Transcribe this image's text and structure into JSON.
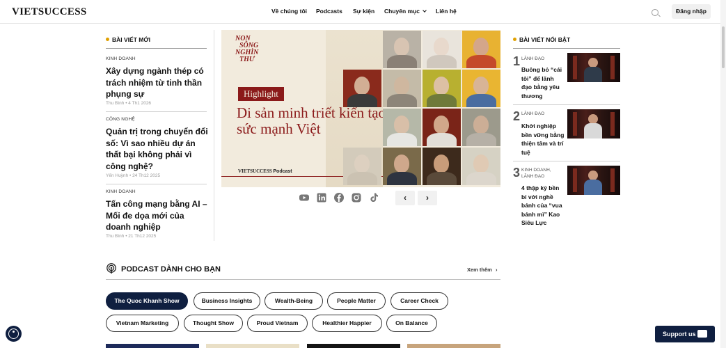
{
  "header": {
    "logo": "VIETSUCCESS",
    "nav": [
      {
        "label": "Về chúng tôi"
      },
      {
        "label": "Podcasts"
      },
      {
        "label": "Sự kiện"
      },
      {
        "label": "Chuyên mục"
      },
      {
        "label": "Liên hệ"
      }
    ],
    "login_label": "Đăng nhập"
  },
  "latest": {
    "title": "BÀI VIẾT MỚI",
    "articles": [
      {
        "category": "KINH DOANH",
        "title": "Xây dựng ngành thép có trách nhiệm từ tinh thần phụng sự",
        "author": "Thu Bình",
        "date": "4 Th1 2026"
      },
      {
        "category": "CÔNG NGHỆ",
        "title": "Quản trị trong chuyển đổi số: Vì sao nhiều dự án thất bại không phải vì công nghệ?",
        "author": "Yến Huỳnh",
        "date": "24 Th12 2025"
      },
      {
        "category": "KINH DOANH",
        "title": "Tấn công mạng bằng AI – Mối đe dọa mới của doanh nghiệp",
        "author": "Thu Bình",
        "date": "21 Th12 2025"
      }
    ]
  },
  "hero": {
    "logo_lines": [
      "NON",
      "SÔNG",
      "NGHÌN",
      "THƯ"
    ],
    "badge": "Highlight",
    "title": "Di sản minh triết kiến tạo sức mạnh Việt",
    "brand": "VIETSUCCESS",
    "brand_suffix": "Podcast"
  },
  "social": [
    {
      "icon": "youtube-icon"
    },
    {
      "icon": "linkedin-icon"
    },
    {
      "icon": "facebook-icon"
    },
    {
      "icon": "instagram-icon"
    },
    {
      "icon": "tiktok-icon"
    }
  ],
  "carousel": {
    "prev": "‹",
    "next": "›"
  },
  "featured": {
    "title": "BÀI VIẾT NỔI BẬT",
    "items": [
      {
        "rank": "1",
        "category": "LÃNH ĐẠO",
        "title": "Buông bỏ “cái tôi” để lãnh đạo bằng yêu thương"
      },
      {
        "rank": "2",
        "category": "LÃNH ĐẠO",
        "title": "Khởi nghiệp bền vững bằng thiện tâm và trí tuệ"
      },
      {
        "rank": "3",
        "category": "KINH DOANH, LÃNH ĐẠO",
        "title": "4 thập kỷ bền bỉ với nghề bánh của “vua bánh mì” Kao Siêu Lực"
      }
    ]
  },
  "podcast": {
    "title": "PODCAST DÀNH CHO BẠN",
    "more_label": "Xem thêm",
    "shows_row1": [
      "The Quoc Khanh Show",
      "Business Insights",
      "Wealth-Being",
      "People Matter",
      "Career Check"
    ],
    "shows_row2": [
      "Vietnam Marketing",
      "Thought Show",
      "Proud Vietnam",
      "Healthier Happier",
      "On Balance"
    ]
  },
  "support_label": "Support us",
  "colors": {
    "accent": "#e0a000",
    "brand_red": "#8b1a1a",
    "navy": "#0f1f40"
  }
}
